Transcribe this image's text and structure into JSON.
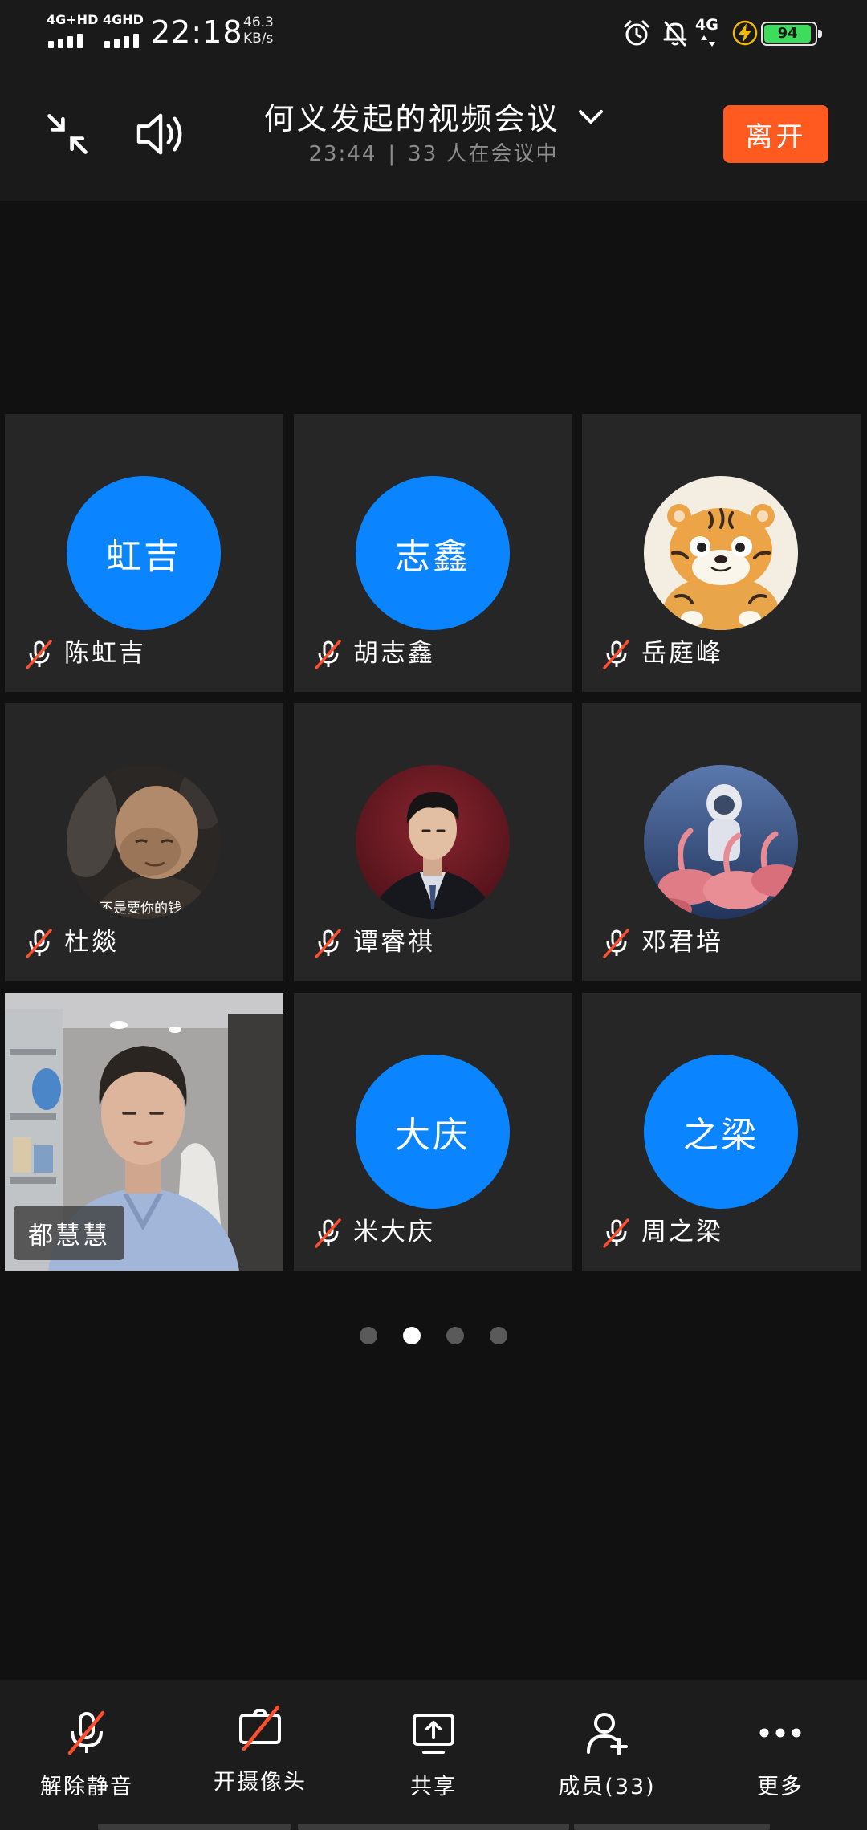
{
  "colors": {
    "avatar_blue": "#0a84ff",
    "leave_button": "#ff5a1f",
    "muted_slash": "#ff4f2e",
    "battery_fill": "#3ddc5c"
  },
  "status_bar": {
    "signal_1": "4G+HD",
    "signal_2": "4GHD",
    "time": "22:18",
    "net_speed": "46.3",
    "net_unit": "KB/s",
    "network_type": "4G",
    "battery": "94",
    "icons": [
      "alarm-icon",
      "bell-off-icon",
      "charging-icon",
      "battery-icon"
    ]
  },
  "header": {
    "minimize_icon": "compress-icon",
    "speaker_icon": "speaker-icon",
    "title": "何义发起的视频会议",
    "duration": "23:44",
    "separator": "|",
    "participants": "33 人在会议中",
    "leave_label": "离开"
  },
  "tiles": [
    {
      "name": "陈虹吉",
      "avatar_type": "initials",
      "initials": "虹吉",
      "muted": true
    },
    {
      "name": "胡志鑫",
      "avatar_type": "initials",
      "initials": "志鑫",
      "muted": true
    },
    {
      "name": "岳庭峰",
      "avatar_type": "image",
      "avatar_icon": "tiger-avatar",
      "muted": true
    },
    {
      "name": "杜燚",
      "avatar_type": "image",
      "avatar_icon": "photo-avatar",
      "avatar_caption": "不是要你的钱",
      "muted": true
    },
    {
      "name": "谭睿祺",
      "avatar_type": "image",
      "avatar_icon": "photo-avatar",
      "muted": true
    },
    {
      "name": "邓君培",
      "avatar_type": "image",
      "avatar_icon": "astronaut-avatar",
      "muted": true
    },
    {
      "name": "都慧慧",
      "avatar_type": "video",
      "muted": false
    },
    {
      "name": "米大庆",
      "avatar_type": "initials",
      "initials": "大庆",
      "muted": true
    },
    {
      "name": "周之梁",
      "avatar_type": "initials",
      "initials": "之梁",
      "muted": true
    }
  ],
  "pagination": {
    "pages": 4,
    "active_page": 2
  },
  "toolbar": {
    "items": [
      {
        "label": "解除静音",
        "icon": "mic-off-icon"
      },
      {
        "label": "开摄像头",
        "icon": "camera-off-icon"
      },
      {
        "label": "共享",
        "icon": "share-screen-icon"
      },
      {
        "label": "成员(33)",
        "icon": "add-member-icon"
      },
      {
        "label": "更多",
        "icon": "more-icon"
      }
    ]
  }
}
